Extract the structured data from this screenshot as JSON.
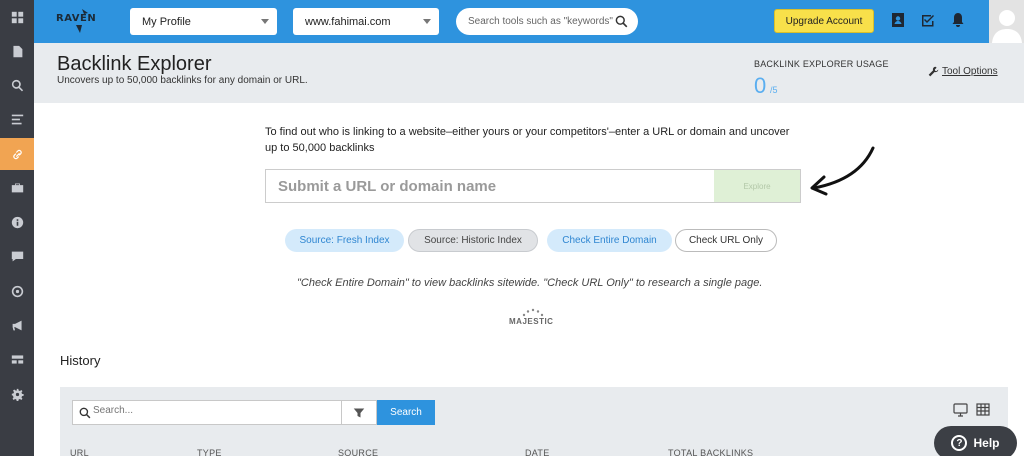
{
  "sidebar": {
    "items": [
      {
        "icon": "dashboard-icon"
      },
      {
        "icon": "document-icon"
      },
      {
        "icon": "search-icon"
      },
      {
        "icon": "list-icon"
      },
      {
        "icon": "link-icon",
        "active": true
      },
      {
        "icon": "briefcase-icon"
      },
      {
        "icon": "info-icon"
      },
      {
        "icon": "chat-icon"
      },
      {
        "icon": "target-icon"
      },
      {
        "icon": "megaphone-icon"
      },
      {
        "icon": "layout-icon"
      },
      {
        "icon": "gear-icon"
      }
    ],
    "active_color": "#f1a452"
  },
  "topbar": {
    "logo_text": "RAVEN",
    "profile_select": "My Profile",
    "domain_select": "www.fahimai.com",
    "search_placeholder": "Search tools such as \"keywords\"",
    "upgrade_label": "Upgrade Account",
    "icons": [
      "contacts-icon",
      "tasks-icon",
      "bell-icon"
    ],
    "accent": "#2e93de"
  },
  "header": {
    "title": "Backlink Explorer",
    "subtitle": "Uncovers up to 50,000 backlinks for any domain or URL.",
    "usage_label": "BACKLINK EXPLORER USAGE",
    "usage_value": "0",
    "usage_unit": "/5",
    "tool_options": "Tool Options"
  },
  "main": {
    "intro": "To find out who is linking to a website–either yours or your competitors'–enter a URL or domain and uncover up to 50,000 backlinks",
    "url_placeholder": "Submit a URL or domain name",
    "explore_label": "Explore",
    "pills": {
      "fresh": "Source: Fresh Index",
      "historic": "Source: Historic Index",
      "entire": "Check Entire Domain",
      "url_only": "Check URL Only"
    },
    "note": "\"Check Entire Domain\" to view backlinks sitewide. \"Check URL Only\" to research a single page.",
    "majestic": "MAJESTIC"
  },
  "history": {
    "title": "History",
    "search_placeholder": "Search...",
    "search_button": "Search",
    "columns": [
      "URL",
      "TYPE",
      "SOURCE",
      "DATE",
      "TOTAL BACKLINKS"
    ]
  },
  "help": {
    "label": "Help"
  }
}
